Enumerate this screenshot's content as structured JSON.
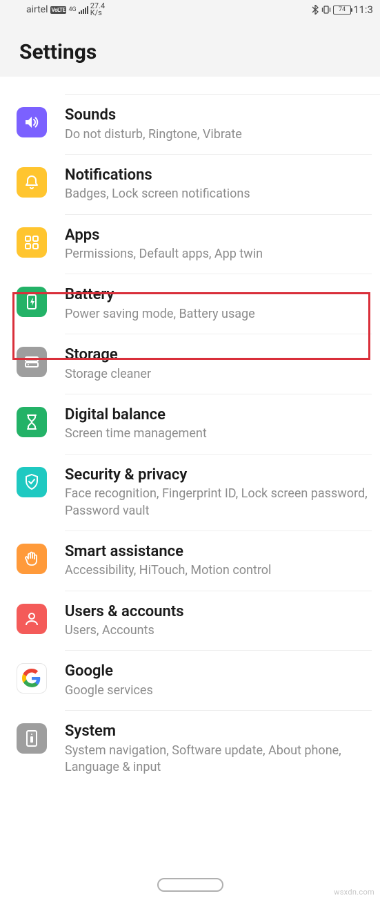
{
  "status": {
    "carrier": "airtel",
    "volte": "VoLTE",
    "net": "4G",
    "speed_top": "27.4",
    "speed_bot": "K/s",
    "battery": "74",
    "time": "11:3"
  },
  "page_title": "Settings",
  "rows": {
    "sounds": {
      "title": "Sounds",
      "sub": "Do not disturb, Ringtone, Vibrate"
    },
    "notifications": {
      "title": "Notifications",
      "sub": "Badges, Lock screen notifications"
    },
    "apps": {
      "title": "Apps",
      "sub": "Permissions, Default apps, App twin"
    },
    "battery": {
      "title": "Battery",
      "sub": "Power saving mode, Battery usage"
    },
    "storage": {
      "title": "Storage",
      "sub": "Storage cleaner"
    },
    "balance": {
      "title": "Digital balance",
      "sub": "Screen time management"
    },
    "security": {
      "title": "Security & privacy",
      "sub": "Face recognition, Fingerprint ID, Lock screen password, Password vault"
    },
    "smart": {
      "title": "Smart assistance",
      "sub": "Accessibility, HiTouch, Motion control"
    },
    "users": {
      "title": "Users & accounts",
      "sub": "Users, Accounts"
    },
    "google": {
      "title": "Google",
      "sub": "Google services"
    },
    "system": {
      "title": "System",
      "sub": "System navigation, Software update, About phone, Language & input"
    }
  },
  "watermark": "wsxdn.com"
}
